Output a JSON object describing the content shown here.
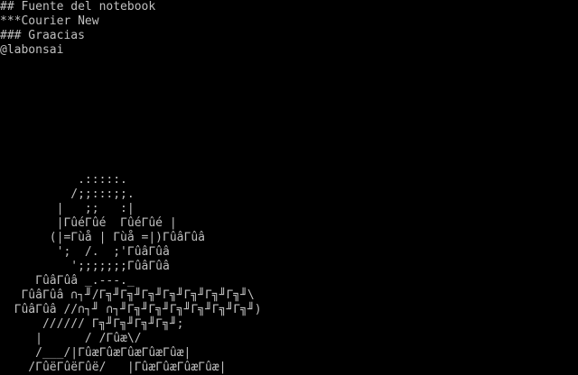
{
  "screen": {
    "background": "#000000",
    "text_color": "#c0c0c0"
  },
  "header_lines": [
    "## Fuente del notebook",
    "***Courier New",
    "### Graacias",
    "@labonsai"
  ],
  "ascii_art_lines": [
    "           .:::::.",
    "          /;;:::;;.",
    "        |   ;;   :|",
    "        |ΓûéΓûé  ΓûéΓûé |",
    "       (|=Γùå | Γùå =|)ΓûâΓûâ",
    "        ';  /.  ;'ΓûâΓûâ",
    "          ';;;;;;;ΓûâΓûâ",
    "     ΓûâΓûâ _.---._",
    "   ΓûâΓûâ ∩┐╜/Γ╗╜Γ╗╜Γ╗╜Γ╗╜Γ╗╜Γ╗╜Γ╗╜\\",
    "  ΓûâΓûâ //∩┐╜ ∩┐╜Γ╗╜Γ╗╜Γ╗╜Γ╗╜Γ╗╜Γ╗╜)",
    "      ////// Γ╗╜Γ╗╜Γ╗╜Γ╗╜;",
    "     |      / /Γûæ\\/",
    "     /___/|ΓûæΓûæΓûæΓûæΓûæ|",
    "    /ΓûëΓûëΓûë/   |ΓûæΓûæΓûæΓûæ|"
  ]
}
